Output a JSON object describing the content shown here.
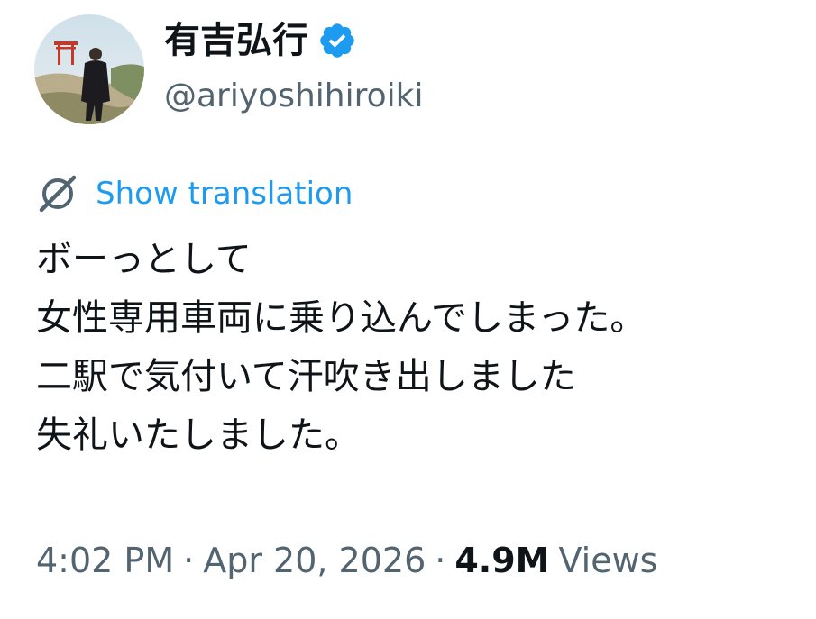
{
  "user": {
    "display_name": "有吉弘行",
    "handle": "@ariyoshihiroiki",
    "verified": true,
    "avatar_icon": "profile-photo",
    "verified_icon": "verified-badge-icon"
  },
  "translate": {
    "icon": "globe-translate-icon",
    "label": "Show translation"
  },
  "tweet": {
    "lines": [
      "ボーっとして",
      "女性専用車両に乗り込んでしまった。",
      "二駅で気付いて汗吹き出しました",
      "失礼いたしました。"
    ]
  },
  "meta": {
    "time": "4:02 PM",
    "separator": "·",
    "date": "Apr 20, 2026",
    "views_count": "4.9M",
    "views_label": "Views"
  },
  "colors": {
    "text": "#0f1419",
    "secondary": "#536471",
    "link": "#1d9bf0",
    "verified": "#1d9bf0"
  }
}
